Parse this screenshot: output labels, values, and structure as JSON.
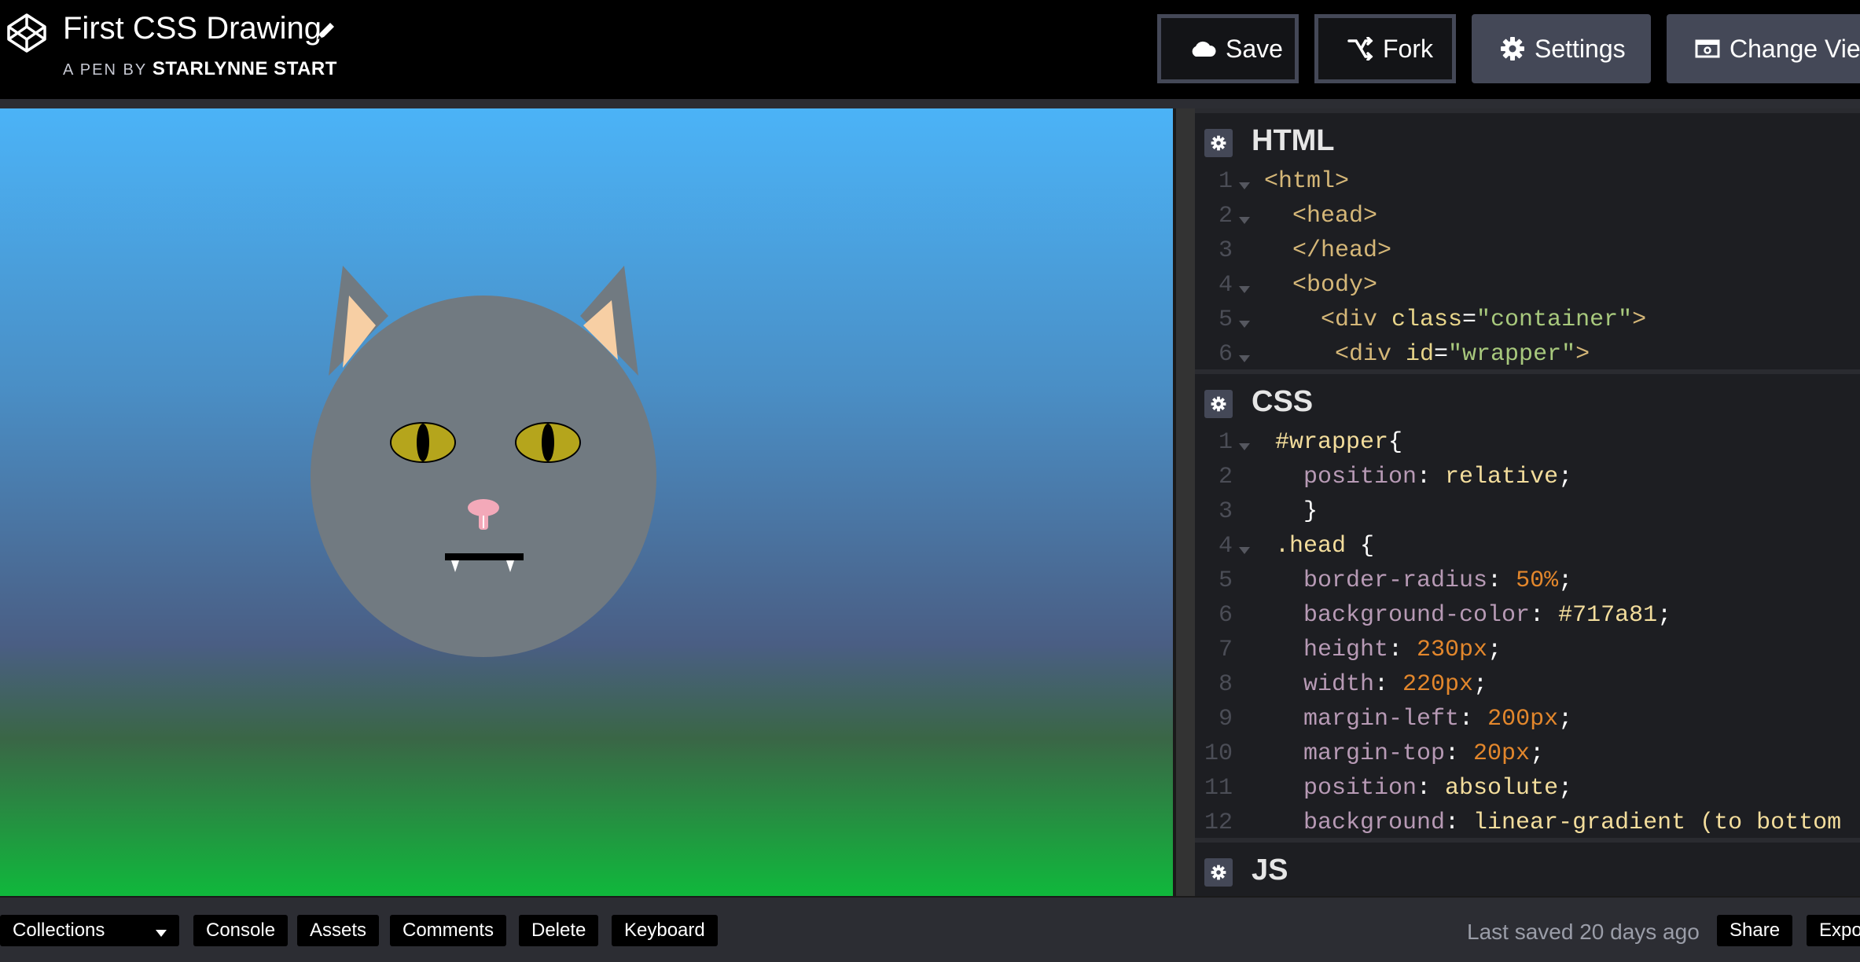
{
  "header": {
    "title": "First CSS Drawing",
    "byline_prefix": "A PEN BY",
    "author": "STARLYNNE START",
    "buttons": {
      "save": "Save",
      "fork": "Fork",
      "settings": "Settings",
      "change_view": "Change View"
    }
  },
  "editors": {
    "html": {
      "title": "HTML",
      "lines": [
        {
          "n": "1",
          "fold": true,
          "indent": 0,
          "tokens": [
            {
              "t": "<html>",
              "c": "tag"
            }
          ]
        },
        {
          "n": "2",
          "fold": true,
          "indent": 1,
          "tokens": [
            {
              "t": "<head>",
              "c": "tag"
            }
          ]
        },
        {
          "n": "3",
          "fold": false,
          "indent": 1,
          "tokens": [
            {
              "t": "</head>",
              "c": "tag"
            }
          ]
        },
        {
          "n": "4",
          "fold": true,
          "indent": 1,
          "tokens": [
            {
              "t": "<body>",
              "c": "tag"
            }
          ]
        },
        {
          "n": "5",
          "fold": true,
          "indent": 2,
          "tokens": [
            {
              "t": "<div ",
              "c": "tag"
            },
            {
              "t": "class",
              "c": "attr"
            },
            {
              "t": "=",
              "c": "punc"
            },
            {
              "t": "\"container\"",
              "c": "str"
            },
            {
              "t": ">",
              "c": "tag"
            }
          ]
        },
        {
          "n": "6",
          "fold": true,
          "indent": 2.5,
          "tokens": [
            {
              "t": "<div ",
              "c": "tag"
            },
            {
              "t": "id",
              "c": "attr"
            },
            {
              "t": "=",
              "c": "punc"
            },
            {
              "t": "\"wrapper\"",
              "c": "str"
            },
            {
              "t": ">",
              "c": "tag"
            }
          ]
        }
      ]
    },
    "css": {
      "title": "CSS",
      "lines": [
        {
          "n": "1",
          "fold": true,
          "indent": 0,
          "tokens": [
            {
              "t": "#wrapper",
              "c": "sel"
            },
            {
              "t": "{",
              "c": "punc"
            }
          ]
        },
        {
          "n": "2",
          "fold": false,
          "indent": 1,
          "tokens": [
            {
              "t": "position",
              "c": "prop"
            },
            {
              "t": ": ",
              "c": "punc"
            },
            {
              "t": "relative",
              "c": "kw"
            },
            {
              "t": ";",
              "c": "punc"
            }
          ]
        },
        {
          "n": "3",
          "fold": false,
          "indent": 1,
          "tokens": [
            {
              "t": "}",
              "c": "punc"
            }
          ]
        },
        {
          "n": "4",
          "fold": true,
          "indent": 0,
          "tokens": [
            {
              "t": ".head",
              "c": "sel"
            },
            {
              "t": " {",
              "c": "punc"
            }
          ]
        },
        {
          "n": "5",
          "fold": false,
          "indent": 1,
          "tokens": [
            {
              "t": "border-radius",
              "c": "prop"
            },
            {
              "t": ": ",
              "c": "punc"
            },
            {
              "t": "50%",
              "c": "num"
            },
            {
              "t": ";",
              "c": "punc"
            }
          ]
        },
        {
          "n": "6",
          "fold": false,
          "indent": 1,
          "tokens": [
            {
              "t": "background-color",
              "c": "prop"
            },
            {
              "t": ": ",
              "c": "punc"
            },
            {
              "t": "#717a81",
              "c": "kw"
            },
            {
              "t": ";",
              "c": "punc"
            }
          ]
        },
        {
          "n": "7",
          "fold": false,
          "indent": 1,
          "tokens": [
            {
              "t": "height",
              "c": "prop"
            },
            {
              "t": ": ",
              "c": "punc"
            },
            {
              "t": "230px",
              "c": "num"
            },
            {
              "t": ";",
              "c": "punc"
            }
          ]
        },
        {
          "n": "8",
          "fold": false,
          "indent": 1,
          "tokens": [
            {
              "t": "width",
              "c": "prop"
            },
            {
              "t": ": ",
              "c": "punc"
            },
            {
              "t": "220px",
              "c": "num"
            },
            {
              "t": ";",
              "c": "punc"
            }
          ]
        },
        {
          "n": "9",
          "fold": false,
          "indent": 1,
          "tokens": [
            {
              "t": "margin-left",
              "c": "prop"
            },
            {
              "t": ": ",
              "c": "punc"
            },
            {
              "t": "200px",
              "c": "num"
            },
            {
              "t": ";",
              "c": "punc"
            }
          ]
        },
        {
          "n": "10",
          "fold": false,
          "indent": 1,
          "tokens": [
            {
              "t": "margin-top",
              "c": "prop"
            },
            {
              "t": ": ",
              "c": "punc"
            },
            {
              "t": "20px",
              "c": "num"
            },
            {
              "t": ";",
              "c": "punc"
            }
          ]
        },
        {
          "n": "11",
          "fold": false,
          "indent": 1,
          "tokens": [
            {
              "t": "position",
              "c": "prop"
            },
            {
              "t": ": ",
              "c": "punc"
            },
            {
              "t": "absolute",
              "c": "kw"
            },
            {
              "t": ";",
              "c": "punc"
            }
          ]
        },
        {
          "n": "12",
          "fold": false,
          "indent": 1,
          "tokens": [
            {
              "t": "background",
              "c": "prop"
            },
            {
              "t": ": ",
              "c": "punc"
            },
            {
              "t": "linear-gradient (to bottom",
              "c": "kw"
            }
          ]
        }
      ]
    },
    "js": {
      "title": "JS"
    }
  },
  "footer": {
    "collections": "Collections",
    "console": "Console",
    "assets": "Assets",
    "comments": "Comments",
    "delete": "Delete",
    "keyboard": "Keyboard",
    "last_saved": "Last saved 20 days ago",
    "share": "Share",
    "export": "Export"
  },
  "colors": {
    "cat_fur": "#717a81",
    "inner_ear": "#f7cfa4",
    "eye": "#b5a51c",
    "nose": "#f3a9b9",
    "grass": "#10b83c",
    "sky": "#4bb3f7"
  }
}
